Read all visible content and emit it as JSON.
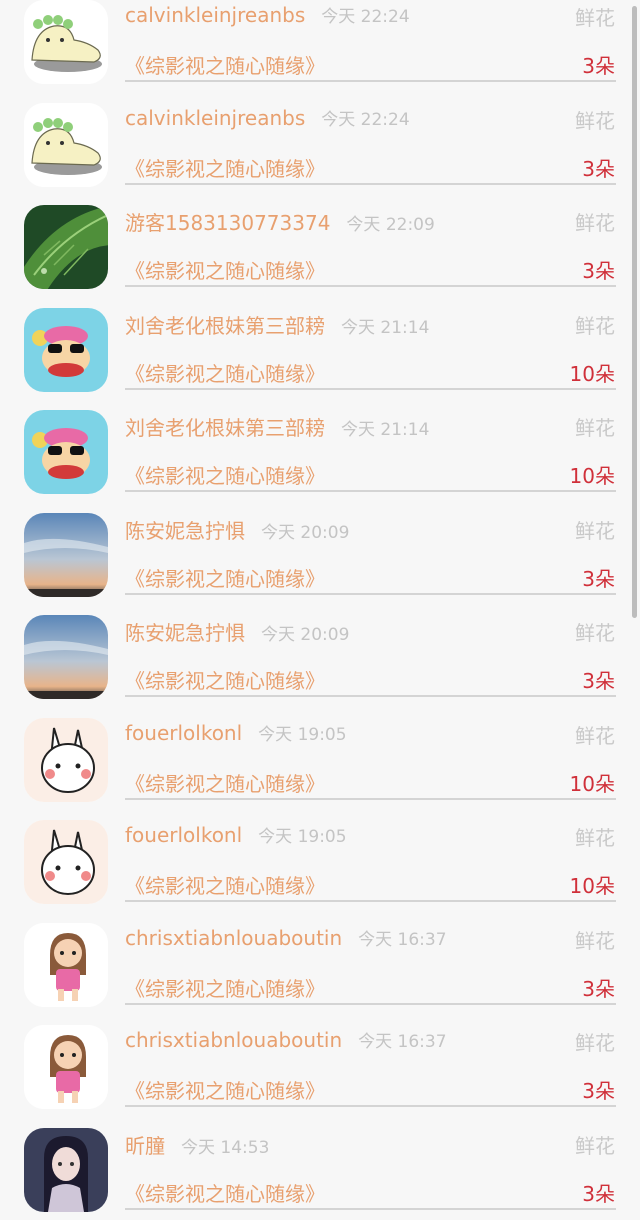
{
  "gift_label": "鲜花",
  "records": [
    {
      "name": "calvinkleinjreanbs",
      "time": "今天 22:24",
      "gift": "鲜花",
      "room": "《综影视之随心随缘》",
      "count": "3朵",
      "avatar": "cartoon-slug-avatar"
    },
    {
      "name": "calvinkleinjreanbs",
      "time": "今天 22:24",
      "gift": "鲜花",
      "room": "《综影视之随心随缘》",
      "count": "3朵",
      "avatar": "cartoon-slug-avatar"
    },
    {
      "name": "游客1583130773374",
      "time": "今天 22:09",
      "gift": "鲜花",
      "room": "《综影视之随心随缘》",
      "count": "3朵",
      "avatar": "green-leaf-avatar"
    },
    {
      "name": "刘舍老化根妹第三部耪",
      "time": "今天 21:14",
      "gift": "鲜花",
      "room": "《综影视之随心随缘》",
      "count": "10朵",
      "avatar": "monkey-avatar"
    },
    {
      "name": "刘舍老化根妹第三部耪",
      "time": "今天 21:14",
      "gift": "鲜花",
      "room": "《综影视之随心随缘》",
      "count": "10朵",
      "avatar": "monkey-avatar"
    },
    {
      "name": "陈安妮急拧惧",
      "time": "今天 20:09",
      "gift": "鲜花",
      "room": "《综影视之随心随缘》",
      "count": "3朵",
      "avatar": "sunset-sky-avatar"
    },
    {
      "name": "陈安妮急拧惧",
      "time": "今天 20:09",
      "gift": "鲜花",
      "room": "《综影视之随心随缘》",
      "count": "3朵",
      "avatar": "sunset-sky-avatar"
    },
    {
      "name": "fouerlolkonl",
      "time": "今天 19:05",
      "gift": "鲜花",
      "room": "《综影视之随心随缘》",
      "count": "10朵",
      "avatar": "bunny-avatar"
    },
    {
      "name": "fouerlolkonl",
      "time": "今天 19:05",
      "gift": "鲜花",
      "room": "《综影视之随心随缘》",
      "count": "10朵",
      "avatar": "bunny-avatar"
    },
    {
      "name": "chrisxtiabnlouaboutin",
      "time": "今天 16:37",
      "gift": "鲜花",
      "room": "《综影视之随心随缘》",
      "count": "3朵",
      "avatar": "cartoon-girl-avatar"
    },
    {
      "name": "chrisxtiabnlouaboutin",
      "time": "今天 16:37",
      "gift": "鲜花",
      "room": "《综影视之随心随缘》",
      "count": "3朵",
      "avatar": "cartoon-girl-avatar"
    },
    {
      "name": "昕朣",
      "time": "今天 14:53",
      "gift": "鲜花",
      "room": "《综影视之随心随缘》",
      "count": "3朵",
      "avatar": "anime-portrait-avatar"
    }
  ],
  "colors": {
    "name": "#e8a06f",
    "time": "#c4c4c4",
    "gift": "#c9c9c9",
    "count": "#d0303a",
    "background": "#f7f7f7"
  }
}
